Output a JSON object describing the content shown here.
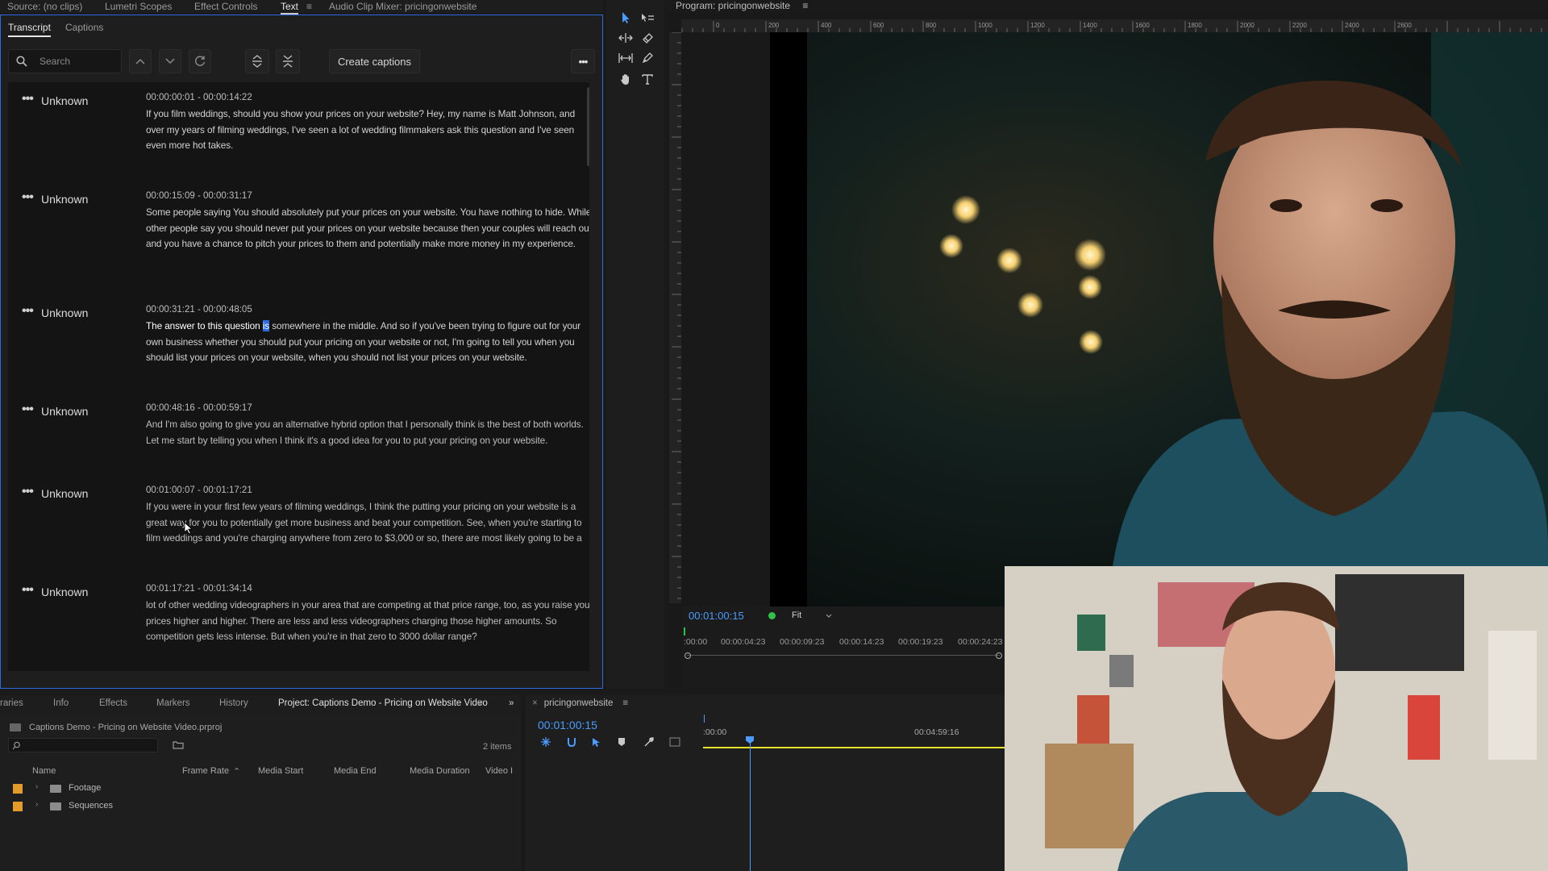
{
  "top_tabs": {
    "source": "Source: (no clips)",
    "lumetri": "Lumetri Scopes",
    "effect_controls": "Effect Controls",
    "text": "Text",
    "audio_mixer": "Audio Clip Mixer: pricingonwebsite",
    "menu_icon": "≡"
  },
  "text_panel": {
    "subtabs": [
      "Transcript",
      "Captions"
    ],
    "search_placeholder": "Search",
    "create_captions_label": "Create captions",
    "more_icon": "•••"
  },
  "transcript": [
    {
      "speaker": "Unknown",
      "timecode": "00:00:00:01 - 00:00:14:22",
      "text": "If you film weddings, should you show your prices on your website? Hey, my name is Matt Johnson, and over my years of filming weddings, I've seen a lot of wedding filmmakers ask this question and I've seen even more hot takes."
    },
    {
      "speaker": "Unknown",
      "timecode": "00:00:15:09 - 00:00:31:17",
      "text": "Some people saying You should absolutely put your prices on your website. You have nothing to hide. While other people say you should never put your prices on your website because then your couples will reach out and you have a chance to pitch your prices to them and potentially make more money in my experience."
    },
    {
      "speaker": "Unknown",
      "timecode": "00:00:31:21 - 00:00:48:05",
      "text_before": "The answer to this question ",
      "highlight": "is",
      "text_after": " somewhere in the middle. And so if you've been trying to figure out for your own business whether you should put your pricing on your website or not, I'm going to tell you when you should list your prices on your website, when you should not list your prices on your website."
    },
    {
      "speaker": "Unknown",
      "timecode": "00:00:48:16 - 00:00:59:17",
      "text": "And I'm also going to give you an alternative hybrid option that I personally think is the best of both worlds. Let me start by telling you when I think it's a good idea for you to put your pricing on your website."
    },
    {
      "speaker": "Unknown",
      "timecode": "00:01:00:07 - 00:01:17:21",
      "text": "If you were in your first few years of filming weddings, I think the putting your pricing on your website is a great way for you to potentially get more business and beat your competition. See, when you're starting to film weddings and you're charging anywhere from zero to $3,000 or so, there are most likely going to be a"
    },
    {
      "speaker": "Unknown",
      "timecode": "00:01:17:21 - 00:01:34:14",
      "text": "lot of other wedding videographers in your area that are competing at that price range, too, as you raise your prices higher and higher. There are less and less videographers charging those higher amounts. So competition gets less intense. But when you're in that zero to 3000 dollar range?"
    }
  ],
  "program": {
    "title": "Program: pricingonwebsite",
    "timecode": "00:01:00:15",
    "fit": "Fit",
    "ruler_top": [
      "200",
      "0",
      "200",
      "400",
      "600",
      "800",
      "1000",
      "1200",
      "1400",
      "1600",
      "1800",
      "2000",
      "2200",
      "2400",
      "2600"
    ],
    "timeline_labels": [
      ":00:00",
      "00:00:04:23",
      "00:00:09:23",
      "00:00:14:23",
      "00:00:19:23",
      "00:00:24:23"
    ]
  },
  "bottom_tabs": [
    "raries",
    "Info",
    "Effects",
    "Markers",
    "History",
    "Project: Captions Demo - Pricing on Website Video",
    "»"
  ],
  "project": {
    "file": "Captions Demo - Pricing on Website Video.prproj",
    "count": "2 items",
    "columns": [
      "Name",
      "Frame Rate",
      "Media Start",
      "Media End",
      "Media Duration",
      "Video I"
    ],
    "rows": [
      {
        "name": "Footage",
        "color": "#e39b2b"
      },
      {
        "name": "Sequences",
        "color": "#e39b2b"
      }
    ]
  },
  "sequence": {
    "tab": "pricingonwebsite",
    "timecode": "00:01:00:15",
    "ruler": [
      ":00:00",
      "00:04:59:16"
    ]
  },
  "colors": {
    "accent_blue": "#2d6ae0",
    "timecode_blue": "#4a9cff",
    "label_orange": "#e39b2b",
    "work_area_yellow": "#e8e02a"
  }
}
